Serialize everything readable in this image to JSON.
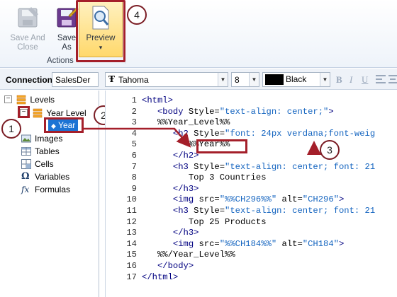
{
  "ribbon": {
    "save_close_label_1": "Save And",
    "save_close_label_2": "Close",
    "save_as_label_1": "Save",
    "save_as_label_2": "As",
    "preview_label": "Preview",
    "preview_arrow": "▾",
    "group_label": "Actions"
  },
  "callouts": {
    "c1": "1",
    "c2": "2",
    "c3": "3",
    "c4": "4"
  },
  "toolbar": {
    "connection_label": "Connection",
    "connection_value": "SalesDer",
    "font_value": "Tahoma",
    "font_icon": "Ŧ",
    "size_value": "8",
    "color_value": "Black",
    "bold": "B",
    "italic": "I",
    "underline": "U",
    "align_icon_names": [
      "align-left-icon",
      "align-center-icon",
      "align-right-icon"
    ]
  },
  "tree": {
    "levels": "Levels",
    "year_level": "Year Level",
    "year": "Year",
    "images": "Images",
    "tables": "Tables",
    "cells": "Cells",
    "variables": "Variables",
    "formulas": "Formulas",
    "collapse_glyph": "−"
  },
  "code": {
    "lines": [
      {
        "num": "1",
        "text": "<html>"
      },
      {
        "num": "2",
        "text": "   <body Style=\"text-align: center;\">"
      },
      {
        "num": "3",
        "text": "   %%Year_Level%%"
      },
      {
        "num": "4",
        "text": "      <h2 Style=\"font: 24px verdana;font-weig"
      },
      {
        "num": "5",
        "text": "         %%Year%%"
      },
      {
        "num": "6",
        "text": "      </h2>"
      },
      {
        "num": "7",
        "text": "      <h3 Style=\"text-align: center; font: 21"
      },
      {
        "num": "8",
        "text": "         Top 3 Countries"
      },
      {
        "num": "9",
        "text": "      </h3>"
      },
      {
        "num": "10",
        "text": "      <img src=\"%%CH296%%\" alt=\"CH296\">"
      },
      {
        "num": "11",
        "text": "      <h3 Style=\"text-align: center; font: 21"
      },
      {
        "num": "12",
        "text": "         Top 25 Products"
      },
      {
        "num": "13",
        "text": "      </h3>"
      },
      {
        "num": "14",
        "text": "      <img src=\"%%CH184%%\" alt=\"CH184\">"
      },
      {
        "num": "15",
        "text": "   %%/Year_Level%%"
      },
      {
        "num": "16",
        "text": "   </body>"
      },
      {
        "num": "17",
        "text": "</html>"
      }
    ]
  },
  "colors": {
    "highlight": "#a41f2a",
    "selection": "#1c74d4",
    "tag": "#000080",
    "string": "#1565c0"
  }
}
